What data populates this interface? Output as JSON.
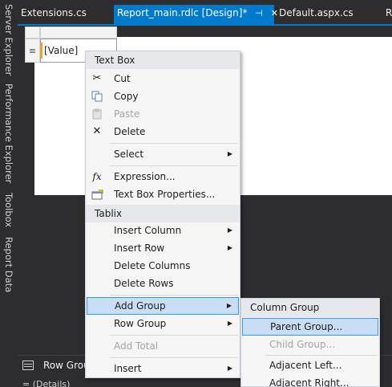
{
  "left_strip": {
    "tabs": [
      "Server Explorer",
      "Performance Explorer",
      "Toolbox",
      "Report Data"
    ]
  },
  "document_tabs": [
    {
      "label": "Extensions.cs",
      "active": false
    },
    {
      "label": "Report_main.rdlc [Design]*",
      "active": true
    },
    {
      "label": "Default.aspx.cs",
      "active": false
    },
    {
      "label": "R",
      "active": false
    }
  ],
  "active_tab_glyphs": {
    "pin": "⊣",
    "close": "✕"
  },
  "designer": {
    "row_handle_glyph": "≡",
    "textbox_value": "[Value]"
  },
  "bottom_panel": {
    "row_groups_label": "Row Grou",
    "details_label": "= (Details)"
  },
  "context_menu": {
    "section_textbox": "Text Box",
    "cut": "Cut",
    "copy": "Copy",
    "paste": "Paste",
    "delete": "Delete",
    "select": "Select",
    "expression": "Expression...",
    "textbox_properties": "Text Box Properties...",
    "section_tablix": "Tablix",
    "insert_column": "Insert Column",
    "insert_row": "Insert Row",
    "delete_columns": "Delete Columns",
    "delete_rows": "Delete Rows",
    "add_group": "Add Group",
    "row_group": "Row Group",
    "add_total": "Add Total",
    "insert": "Insert",
    "icons": {
      "cut": "scissors-icon",
      "copy": "copy-icon",
      "paste": "paste-icon",
      "delete": "delete-x-icon",
      "expression": "fx-icon",
      "textbox_properties": "properties-icon"
    }
  },
  "submenu": {
    "header": "Column Group",
    "parent_group": "Parent Group...",
    "child_group": "Child Group...",
    "adjacent_left": "Adjacent Left...",
    "adjacent_right": "Adjacent Right..."
  },
  "colors": {
    "accent": "#007acc",
    "ide_background": "#2d2d30",
    "menu_background": "#f5f5f5",
    "menu_hover": "#c9def5",
    "menu_hover_border": "#3399ff"
  }
}
